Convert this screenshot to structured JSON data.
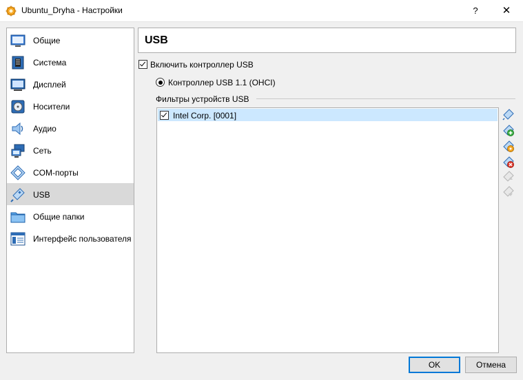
{
  "window": {
    "title": "Ubuntu_Dryha - Настройки",
    "help": "?",
    "close": "✕"
  },
  "sidebar": {
    "items": [
      {
        "label": "Общие",
        "icon": "general-icon"
      },
      {
        "label": "Система",
        "icon": "system-icon"
      },
      {
        "label": "Дисплей",
        "icon": "display-icon"
      },
      {
        "label": "Носители",
        "icon": "storage-icon"
      },
      {
        "label": "Аудио",
        "icon": "audio-icon"
      },
      {
        "label": "Сеть",
        "icon": "network-icon"
      },
      {
        "label": "COM-порты",
        "icon": "serial-ports-icon"
      },
      {
        "label": "USB",
        "icon": "usb-icon",
        "active": true
      },
      {
        "label": "Общие папки",
        "icon": "shared-folders-icon"
      },
      {
        "label": "Интерфейс пользователя",
        "icon": "user-interface-icon"
      }
    ]
  },
  "main": {
    "header": "USB",
    "enable_usb": {
      "label": "Включить контроллер USB",
      "checked": true
    },
    "controller": {
      "label": "Контроллер USB 1.1 (OHCI)",
      "selected": true
    },
    "filters_label": "Фильтры устройств USB",
    "filters": [
      {
        "label": "Intel Corp.  [0001]",
        "checked": true
      }
    ]
  },
  "tools": [
    {
      "icon": "add-empty-filter-icon"
    },
    {
      "icon": "add-filter-from-device-icon"
    },
    {
      "icon": "edit-filter-icon"
    },
    {
      "icon": "remove-filter-icon"
    },
    {
      "icon": "move-filter-up-icon"
    },
    {
      "icon": "move-filter-down-icon"
    }
  ],
  "buttons": {
    "ok": "OK",
    "cancel": "Отмена"
  },
  "colors": {
    "selection": "#cce8ff",
    "sidebar_active": "#d9d9d9",
    "default_button_border": "#0078d7"
  }
}
